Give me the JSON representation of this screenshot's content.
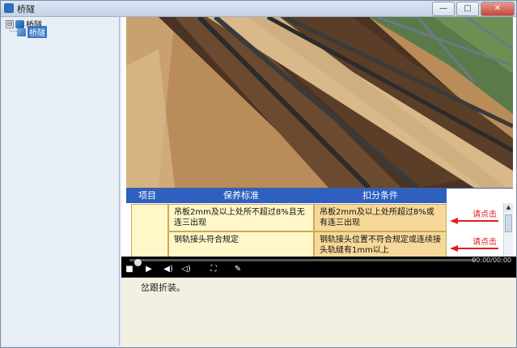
{
  "window": {
    "title": "桥隧",
    "controls": {
      "minimize": "—",
      "maximize": "□",
      "close": "✕"
    }
  },
  "tree": {
    "root": {
      "label": "桥隧",
      "expander": "⊟"
    },
    "child": {
      "label": "桥隧"
    }
  },
  "table": {
    "headers": [
      "项目",
      "保养标准",
      "扣分条件"
    ],
    "rows": [
      {
        "item": "",
        "standard": "吊板2mm及以上处所不超过8%且无连三出现",
        "deduction": "吊板2mm及以上处所超过8%或有连三出现",
        "action": "请点击"
      },
      {
        "item": "",
        "standard": "钢轨接头符合规定",
        "deduction": "钢轨接头位置不符合规定或连续接头轨缝有1mm以上",
        "action": "请点击"
      }
    ]
  },
  "player": {
    "time": "00:00/00:00",
    "progress": 0.0,
    "icons": [
      "stop-icon",
      "play-icon",
      "volume-icon",
      "mute-icon",
      "fullscreen-icon",
      "edit-icon"
    ]
  },
  "description": {
    "text": "岔跟折装。"
  },
  "colors": {
    "header_blue": "#2f5fbf",
    "link_red": "#e02020",
    "cell_yellow": "#fff7c8",
    "cell_orange": "#f6d99a"
  }
}
